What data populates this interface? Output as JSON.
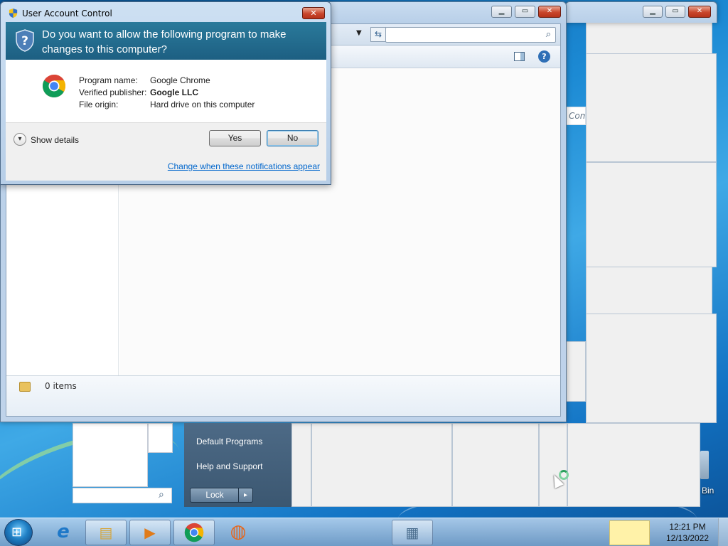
{
  "uac": {
    "title": "User Account Control",
    "question": "Do you want to allow the following program to make changes to this computer?",
    "rows": [
      {
        "label": "Program name:",
        "value": "Google Chrome"
      },
      {
        "label": "Verified publisher:",
        "value": "Google LLC"
      },
      {
        "label": "File origin:",
        "value": "Hard drive on this computer"
      }
    ],
    "show_details": "Show details",
    "yes": "Yes",
    "no": "No",
    "change_link": "Change when these notifications appear",
    "close": "✕"
  },
  "explorer": {
    "item_count": "0 items",
    "minimize": "▁",
    "maximize": "▭",
    "close": "✕",
    "search_icon": "⌕",
    "help_icon": "?"
  },
  "background_window": {
    "partial_column": "Com",
    "minimize": "▁",
    "maximize": "▭",
    "close": "✕"
  },
  "start_menu": {
    "items": [
      "Default Programs",
      "Help and Support"
    ],
    "lock": "Lock",
    "arrow": "▸"
  },
  "desktop": {
    "recycle_bin_label": "Bin"
  },
  "taskbar": {
    "start_glyph": "⊞",
    "buttons": [
      {
        "name": "internet-explorer",
        "glyph": "e",
        "color": "#1e78c8"
      },
      {
        "name": "windows-explorer",
        "glyph": "▤",
        "color": "#d6a437"
      },
      {
        "name": "media-player",
        "glyph": "▶",
        "color": "#e07b1a"
      },
      {
        "name": "chrome",
        "glyph": "◉",
        "color": "#2a8a3a"
      },
      {
        "name": "firefox",
        "glyph": "◍",
        "color": "#e5661c"
      },
      {
        "name": "calculator",
        "glyph": "▦",
        "color": "#4c6f8f"
      }
    ],
    "time": "12:21 PM",
    "date": "12/13/2022"
  }
}
